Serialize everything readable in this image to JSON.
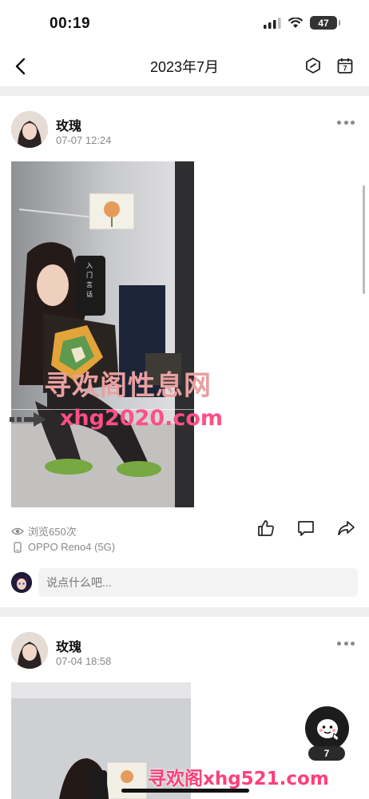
{
  "status_bar": {
    "time": "00:19",
    "battery": "47"
  },
  "nav": {
    "title": "2023年7月"
  },
  "posts": [
    {
      "user": "玫瑰",
      "time": "07-07 12:24",
      "views": "浏览650次",
      "device": "OPPO Reno4 (5G)",
      "comment_placeholder": "说点什么吧..."
    },
    {
      "user": "玫瑰",
      "time": "07-04 18:58"
    }
  ],
  "poster_text": [
    "入",
    "门",
    "言",
    "话"
  ],
  "watermarks": {
    "main": "寻欢阁性息网",
    "url": "xhg2020.com",
    "bottom": "寻欢阁xhg521.com"
  },
  "float_badge": "7",
  "colors": {
    "accent": "#ff4f86",
    "meta": "#8a8a8a"
  }
}
